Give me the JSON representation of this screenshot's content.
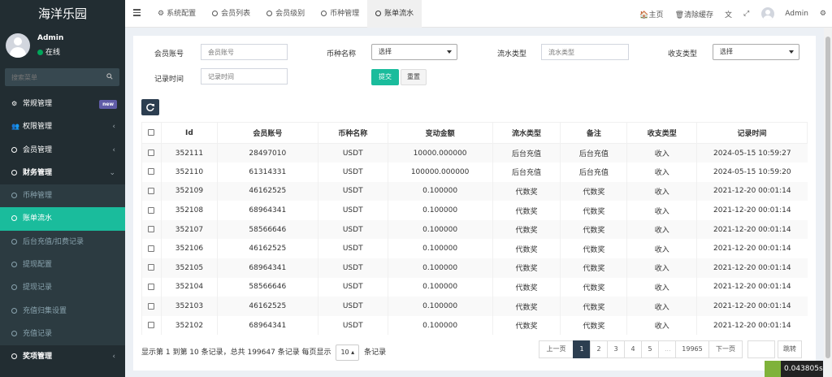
{
  "app": {
    "title": "海洋乐园"
  },
  "user": {
    "name": "Admin",
    "status": "在线"
  },
  "sidebar": {
    "search_placeholder": "搜索菜单",
    "items": [
      {
        "label": "常规管理",
        "badge": "new"
      },
      {
        "label": "权限管理"
      },
      {
        "label": "会员管理"
      },
      {
        "label": "财务管理"
      }
    ],
    "sub_items": [
      {
        "label": "币种管理"
      },
      {
        "label": "账单流水"
      },
      {
        "label": "后台充值/扣费记录"
      },
      {
        "label": "提现配置"
      },
      {
        "label": "提现记录"
      },
      {
        "label": "充值归集设置"
      },
      {
        "label": "充值记录"
      }
    ],
    "bottom_item": {
      "label": "奖项管理"
    }
  },
  "topbar": {
    "tabs": [
      {
        "label": "系统配置"
      },
      {
        "label": "会员列表"
      },
      {
        "label": "会员级别"
      },
      {
        "label": "币种管理"
      },
      {
        "label": "账单流水"
      }
    ],
    "home": "主页",
    "clear_cache": "清除缓存",
    "user": "Admin"
  },
  "filters": {
    "member_account_label": "会员账号",
    "member_account_placeholder": "会员账号",
    "currency_label": "币种名称",
    "currency_value": "选择",
    "flow_type_label": "流水类型",
    "flow_type_placeholder": "流水类型",
    "income_type_label": "收支类型",
    "income_type_value": "选择",
    "record_time_label": "记录时间",
    "record_time_placeholder": "记录时间",
    "submit": "提交",
    "reset": "重置"
  },
  "table": {
    "headers": [
      "Id",
      "会员账号",
      "币种名称",
      "变动金额",
      "流水类型",
      "备注",
      "收支类型",
      "记录时间"
    ],
    "rows": [
      [
        "352111",
        "28497010",
        "USDT",
        "10000.000000",
        "后台充值",
        "后台充值",
        "收入",
        "2024-05-15 10:59:27"
      ],
      [
        "352110",
        "61314331",
        "USDT",
        "100000.000000",
        "后台充值",
        "后台充值",
        "收入",
        "2024-05-15 10:59:20"
      ],
      [
        "352109",
        "46162525",
        "USDT",
        "0.100000",
        "代数奖",
        "代数奖",
        "收入",
        "2021-12-20 00:01:14"
      ],
      [
        "352108",
        "68964341",
        "USDT",
        "0.100000",
        "代数奖",
        "代数奖",
        "收入",
        "2021-12-20 00:01:14"
      ],
      [
        "352107",
        "58566646",
        "USDT",
        "0.100000",
        "代数奖",
        "代数奖",
        "收入",
        "2021-12-20 00:01:14"
      ],
      [
        "352106",
        "46162525",
        "USDT",
        "0.100000",
        "代数奖",
        "代数奖",
        "收入",
        "2021-12-20 00:01:14"
      ],
      [
        "352105",
        "68964341",
        "USDT",
        "0.100000",
        "代数奖",
        "代数奖",
        "收入",
        "2021-12-20 00:01:14"
      ],
      [
        "352104",
        "58566646",
        "USDT",
        "0.100000",
        "代数奖",
        "代数奖",
        "收入",
        "2021-12-20 00:01:14"
      ],
      [
        "352103",
        "46162525",
        "USDT",
        "0.100000",
        "代数奖",
        "代数奖",
        "收入",
        "2021-12-20 00:01:14"
      ],
      [
        "352102",
        "68964341",
        "USDT",
        "0.100000",
        "代数奖",
        "代数奖",
        "收入",
        "2021-12-20 00:01:14"
      ]
    ]
  },
  "pagination": {
    "info": "显示第 1 到第 10 条记录，总共 199647 条记录 每页显示",
    "page_size": "10",
    "info_suffix": "条记录",
    "prev": "上一页",
    "pages": [
      "1",
      "2",
      "3",
      "4",
      "5",
      "...",
      "19965"
    ],
    "next": "下一页",
    "jump": "跳转"
  },
  "timer": {
    "value": "0.043805s"
  },
  "colors": {
    "accent": "#1abc9c",
    "sidebar_bg": "#222d32",
    "dark_button": "#2c3e50"
  }
}
